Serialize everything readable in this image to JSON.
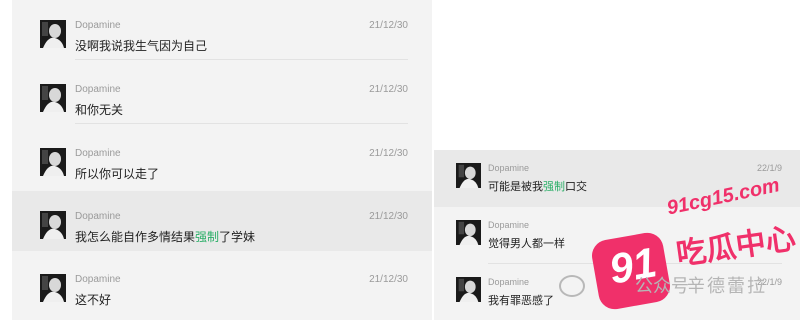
{
  "left_chat": {
    "messages": [
      {
        "sender": "Dopamine",
        "date": "21/12/30",
        "text_before": "没啊我说我生气因为自己",
        "highlight": "",
        "text_after": ""
      },
      {
        "sender": "Dopamine",
        "date": "21/12/30",
        "text_before": "和你无关",
        "highlight": "",
        "text_after": ""
      },
      {
        "sender": "Dopamine",
        "date": "21/12/30",
        "text_before": "所以你可以走了",
        "highlight": "",
        "text_after": ""
      },
      {
        "sender": "Dopamine",
        "date": "21/12/30",
        "text_before": "我怎么能自作多情结果",
        "highlight": "强制",
        "text_after": "了学妹"
      },
      {
        "sender": "Dopamine",
        "date": "21/12/30",
        "text_before": "这不好",
        "highlight": "",
        "text_after": ""
      }
    ]
  },
  "right_chat": {
    "messages": [
      {
        "sender": "Dopamine",
        "date": "22/1/9",
        "text_before": "可能是被我",
        "highlight": "强制",
        "text_after": "口交"
      },
      {
        "sender": "Dopamine",
        "date": "",
        "text_before": "觉得男人都一样",
        "highlight": "",
        "text_after": ""
      },
      {
        "sender": "Dopamine",
        "date": "22/1/9",
        "text_before": "我有罪恶感了",
        "highlight": "",
        "text_after": ""
      }
    ]
  },
  "watermark": {
    "site": "91cg15.com",
    "badge_number": "91",
    "brand": "吃瓜中心",
    "gzh": "公众号",
    "author": "辛德蕾拉"
  },
  "colors": {
    "highlight_text": "#2aae67",
    "watermark_pink": "#f0306a"
  }
}
